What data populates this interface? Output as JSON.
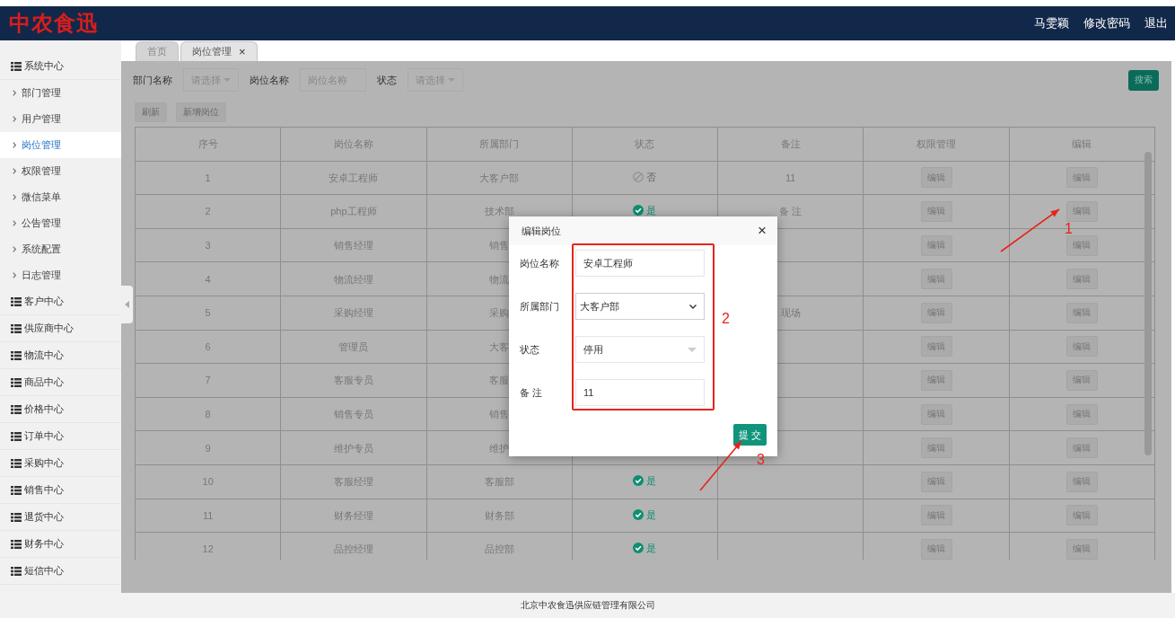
{
  "header": {
    "logo": "中农食迅",
    "user": "马雯颖",
    "links": [
      "修改密码",
      "退出"
    ]
  },
  "sidebar": {
    "items": [
      {
        "label": "系统中心",
        "children": [
          {
            "label": "部门管理",
            "selected": false
          },
          {
            "label": "用户管理",
            "selected": false
          },
          {
            "label": "岗位管理",
            "selected": true
          },
          {
            "label": "权限管理",
            "selected": false
          },
          {
            "label": "微信菜单",
            "selected": false
          },
          {
            "label": "公告管理",
            "selected": false
          },
          {
            "label": "系统配置",
            "selected": false
          },
          {
            "label": "日志管理",
            "selected": false
          }
        ]
      },
      {
        "label": "客户中心"
      },
      {
        "label": "供应商中心"
      },
      {
        "label": "物流中心"
      },
      {
        "label": "商品中心"
      },
      {
        "label": "价格中心"
      },
      {
        "label": "订单中心"
      },
      {
        "label": "采购中心"
      },
      {
        "label": "销售中心"
      },
      {
        "label": "退货中心"
      },
      {
        "label": "财务中心"
      },
      {
        "label": "短信中心"
      }
    ]
  },
  "tabs": [
    {
      "label": "首页",
      "selected": false
    },
    {
      "label": "岗位管理",
      "selected": true,
      "close": "×"
    }
  ],
  "filters": [
    {
      "kind": "select",
      "label": "部门名称",
      "placeholder": "请选择"
    },
    {
      "kind": "input",
      "label": "岗位名称",
      "placeholder": "岗位名称"
    },
    {
      "kind": "select",
      "label": "状态",
      "placeholder": "请选择"
    }
  ],
  "search_button": "搜索",
  "actions": [
    "刷新",
    "新增岗位"
  ],
  "table": {
    "columns": [
      "序号",
      "岗位名称",
      "所属部门",
      "状态",
      "备注",
      "权限管理",
      "编辑"
    ],
    "rows": [
      {
        "no": "1",
        "name": "安卓工程师",
        "dept": "大客户部",
        "status": {
          "kind": "no",
          "label": "否"
        },
        "remark": "11",
        "perm": "编辑",
        "edit": "编辑"
      },
      {
        "no": "2",
        "name": "php工程师",
        "dept": "技术部",
        "status": {
          "kind": "yes",
          "label": "是"
        },
        "remark": "备 注",
        "perm": "编辑",
        "edit": "编辑"
      },
      {
        "no": "3",
        "name": "销售经理",
        "dept": "销售",
        "perm": "编辑",
        "edit": "编辑"
      },
      {
        "no": "4",
        "name": "物流经理",
        "dept": "物流",
        "perm": "编辑",
        "edit": "编辑"
      },
      {
        "no": "5",
        "name": "采购经理",
        "dept": "采购",
        "remark": "现场",
        "perm": "编辑",
        "edit": "编辑"
      },
      {
        "no": "6",
        "name": "管理员",
        "dept": "大客",
        "perm": "编辑",
        "edit": "编辑"
      },
      {
        "no": "7",
        "name": "客服专员",
        "dept": "客服",
        "perm": "编辑",
        "edit": "编辑"
      },
      {
        "no": "8",
        "name": "销售专员",
        "dept": "销售",
        "perm": "编辑",
        "edit": "编辑"
      },
      {
        "no": "9",
        "name": "维护专员",
        "dept": "维护",
        "perm": "编辑",
        "edit": "编辑"
      },
      {
        "no": "10",
        "name": "客服经理",
        "dept": "客服部",
        "status": {
          "kind": "yes",
          "label": "是"
        },
        "perm": "编辑",
        "edit": "编辑"
      },
      {
        "no": "11",
        "name": "财务经理",
        "dept": "财务部",
        "status": {
          "kind": "yes",
          "label": "是"
        },
        "perm": "编辑",
        "edit": "编辑"
      },
      {
        "no": "12",
        "name": "品控经理",
        "dept": "品控部",
        "status": {
          "kind": "yes",
          "label": "是"
        },
        "perm": "编辑",
        "edit": "编辑"
      }
    ]
  },
  "dialog": {
    "title": "编辑岗位",
    "close": "×",
    "fields": [
      {
        "kind": "text",
        "label": "岗位名称",
        "value": "安卓工程师"
      },
      {
        "kind": "native-select",
        "label": "所属部门",
        "value": "大客户部"
      },
      {
        "kind": "dropdown",
        "label": "状态",
        "value": "停用"
      },
      {
        "kind": "text",
        "label": "备 注",
        "value": "11"
      }
    ],
    "submit": "提 交"
  },
  "annotations": [
    {
      "label": "1"
    },
    {
      "label": "2"
    },
    {
      "label": "3"
    }
  ],
  "footer": "北京中农食迅供应链管理有限公司"
}
